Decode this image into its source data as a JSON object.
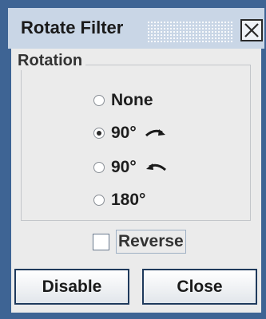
{
  "window": {
    "title": "Rotate Filter"
  },
  "group": {
    "title": "Rotation"
  },
  "options": [
    {
      "label": "None",
      "selected": false,
      "icon": ""
    },
    {
      "label": "90°",
      "selected": true,
      "icon": "rotate-clockwise-icon"
    },
    {
      "label": "90°",
      "selected": false,
      "icon": "rotate-counterclockwise-icon"
    },
    {
      "label": "180°",
      "selected": false,
      "icon": ""
    }
  ],
  "reverse": {
    "label": "Reverse",
    "checked": false
  },
  "buttons": {
    "disable_label": "Disable",
    "close_label": "Close"
  },
  "colors": {
    "window_frame": "#3e6494",
    "titlebar": "#c9d6e6",
    "content_bg": "#ebebeb"
  }
}
